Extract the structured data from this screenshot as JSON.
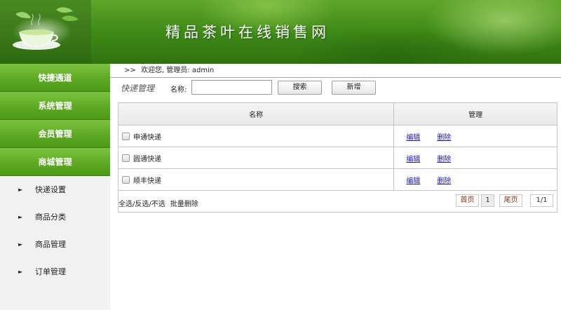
{
  "site": {
    "title": "精品茶叶在线销售网"
  },
  "sidebar": {
    "groups": [
      {
        "label": "快捷通道"
      },
      {
        "label": "系统管理"
      },
      {
        "label": "会员管理"
      },
      {
        "label": "商城管理"
      }
    ],
    "items": [
      {
        "arrow": "►",
        "label": "快递设置"
      },
      {
        "arrow": "►",
        "label": "商品分类"
      },
      {
        "arrow": "►",
        "label": "商品管理"
      },
      {
        "arrow": "►",
        "label": "订单管理"
      }
    ]
  },
  "header": {
    "welcome_prefix": ">>",
    "welcome_text": "欢迎您, 管理员: admin"
  },
  "toolbar": {
    "section_title": "快递管理",
    "name_label": "名称:",
    "search_value": "",
    "search_label": "搜索",
    "add_label": "新增"
  },
  "table": {
    "columns": [
      "名称",
      "管理"
    ],
    "rows": [
      {
        "name": "申通快递",
        "edit": "编辑",
        "delete": "删除"
      },
      {
        "name": "圆通快递",
        "edit": "编辑",
        "delete": "删除"
      },
      {
        "name": "顺丰快递",
        "edit": "编辑",
        "delete": "删除"
      }
    ]
  },
  "footer": {
    "select_all": "全选",
    "invert": "反选",
    "select_none": "不选",
    "batch_delete": "批量删除",
    "pager": {
      "first": "首页",
      "page": "1",
      "last": "尾页",
      "info": "1/1"
    }
  },
  "colors": {
    "brand_green": "#5ea924",
    "link_blue": "#1a1aa8",
    "sidebar_bg": "#f1f1f1"
  },
  "icons": {
    "sidebar_arrow": "triangle-right-icon",
    "logo": "tea-cup-logo"
  }
}
